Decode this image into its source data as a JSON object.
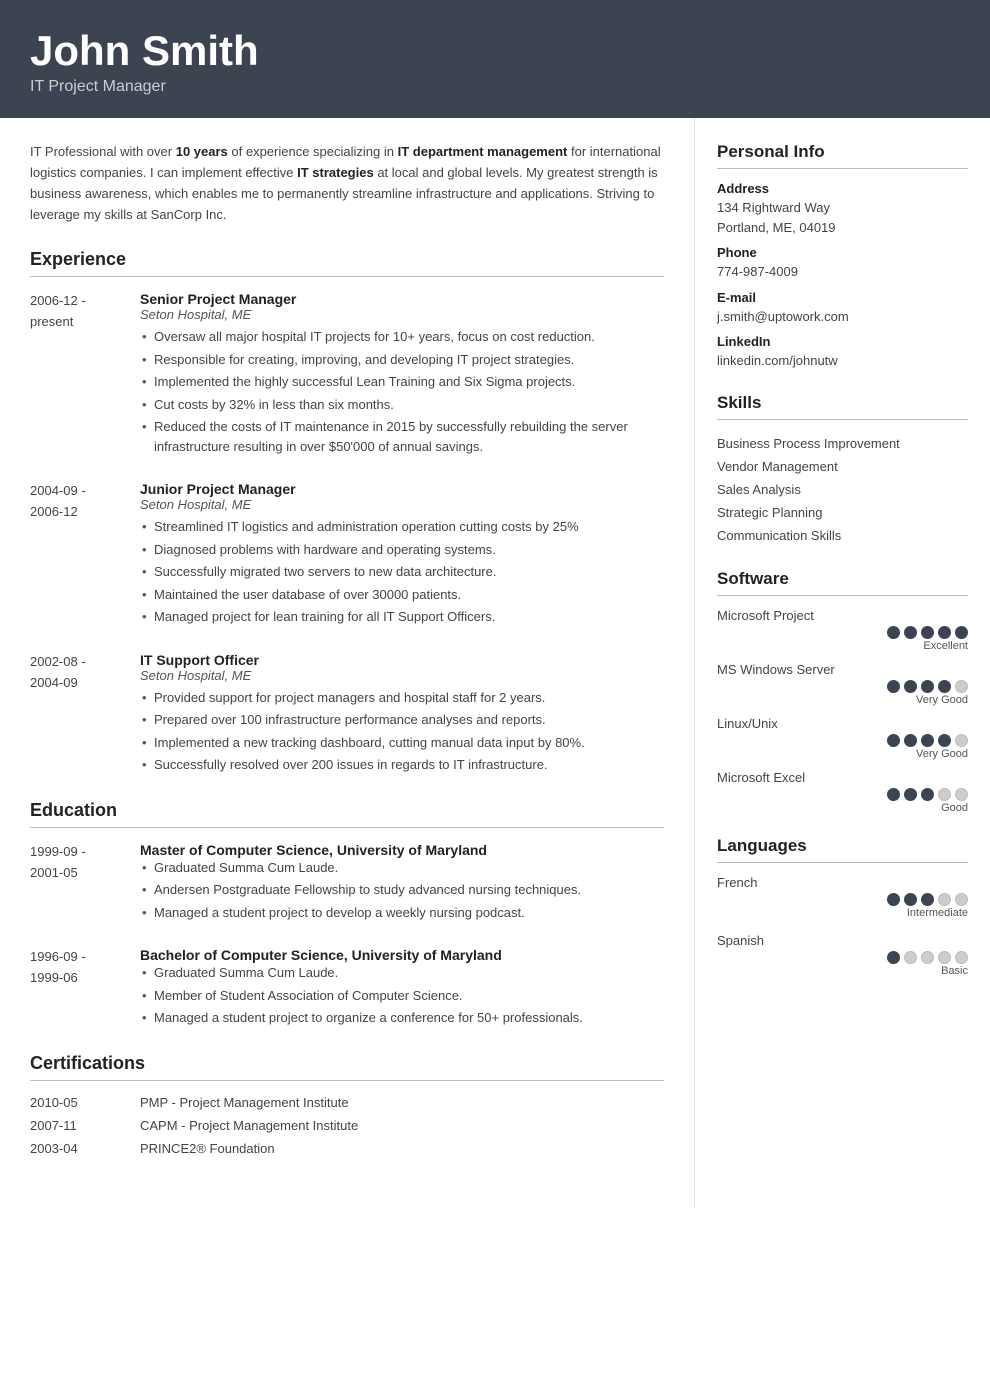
{
  "header": {
    "name": "John Smith",
    "title": "IT Project Manager"
  },
  "summary": {
    "text_parts": [
      "IT Professional with over ",
      "10 years",
      " of experience specializing in ",
      "IT department management",
      " for international logistics companies. I can implement effective ",
      "IT strategies",
      " at local and global levels. My greatest strength is business awareness, which enables me to permanently streamline infrastructure and applications. Striving to leverage my skills at SanCorp Inc."
    ]
  },
  "experience": {
    "section_title": "Experience",
    "entries": [
      {
        "date_start": "2006-12 -",
        "date_end": "present",
        "role": "Senior Project Manager",
        "org": "Seton Hospital, ME",
        "bullets": [
          "Oversaw all major hospital IT projects for 10+ years, focus on cost reduction.",
          "Responsible for creating, improving, and developing IT project strategies.",
          "Implemented the highly successful Lean Training and Six Sigma projects.",
          "Cut costs by 32% in less than six months.",
          "Reduced the costs of IT maintenance in 2015 by successfully rebuilding the server infrastructure resulting in over $50'000 of annual savings."
        ]
      },
      {
        "date_start": "2004-09 -",
        "date_end": "2006-12",
        "role": "Junior Project Manager",
        "org": "Seton Hospital, ME",
        "bullets": [
          "Streamlined IT logistics and administration operation cutting costs by 25%",
          "Diagnosed problems with hardware and operating systems.",
          "Successfully migrated two servers to new data architecture.",
          "Maintained the user database of over 30000 patients.",
          "Managed project for lean training for all IT Support Officers."
        ]
      },
      {
        "date_start": "2002-08 -",
        "date_end": "2004-09",
        "role": "IT Support Officer",
        "org": "Seton Hospital, ME",
        "bullets": [
          "Provided support for project managers and hospital staff for 2 years.",
          "Prepared over 100 infrastructure performance analyses and reports.",
          "Implemented a new tracking dashboard, cutting manual data input by 80%.",
          "Successfully resolved over 200 issues in regards to IT infrastructure."
        ]
      }
    ]
  },
  "education": {
    "section_title": "Education",
    "entries": [
      {
        "date_start": "1999-09 -",
        "date_end": "2001-05",
        "role": "Master of Computer Science, University of Maryland",
        "org": "",
        "bullets": [
          "Graduated Summa Cum Laude.",
          "Andersen Postgraduate Fellowship to study advanced nursing techniques.",
          "Managed a student project to develop a weekly nursing podcast."
        ]
      },
      {
        "date_start": "1996-09 -",
        "date_end": "1999-06",
        "role": "Bachelor of Computer Science, University of Maryland",
        "org": "",
        "bullets": [
          "Graduated Summa Cum Laude.",
          "Member of Student Association of Computer Science.",
          "Managed a student project to organize a conference for 50+ professionals."
        ]
      }
    ]
  },
  "certifications": {
    "section_title": "Certifications",
    "entries": [
      {
        "date": "2010-05",
        "name": "PMP - Project Management Institute"
      },
      {
        "date": "2007-11",
        "name": "CAPM - Project Management Institute"
      },
      {
        "date": "2003-04",
        "name": "PRINCE2® Foundation"
      }
    ]
  },
  "personal_info": {
    "section_title": "Personal Info",
    "fields": [
      {
        "label": "Address",
        "value": "134 Rightward Way\nPortland, ME, 04019"
      },
      {
        "label": "Phone",
        "value": "774-987-4009"
      },
      {
        "label": "E-mail",
        "value": "j.smith@uptowork.com"
      },
      {
        "label": "LinkedIn",
        "value": "linkedin.com/johnutw"
      }
    ]
  },
  "skills": {
    "section_title": "Skills",
    "items": [
      "Business Process Improvement",
      "Vendor Management",
      "Sales Analysis",
      "Strategic Planning",
      "Communication Skills"
    ]
  },
  "software": {
    "section_title": "Software",
    "items": [
      {
        "name": "Microsoft Project",
        "filled": 5,
        "total": 5,
        "label": "Excellent"
      },
      {
        "name": "MS Windows Server",
        "filled": 4,
        "total": 5,
        "label": "Very Good"
      },
      {
        "name": "Linux/Unix",
        "filled": 4,
        "total": 5,
        "label": "Very Good"
      },
      {
        "name": "Microsoft Excel",
        "filled": 3,
        "total": 5,
        "label": "Good"
      }
    ]
  },
  "languages": {
    "section_title": "Languages",
    "items": [
      {
        "name": "French",
        "filled": 3,
        "total": 5,
        "label": "Intermediate"
      },
      {
        "name": "Spanish",
        "filled": 1,
        "total": 5,
        "label": "Basic"
      }
    ]
  }
}
